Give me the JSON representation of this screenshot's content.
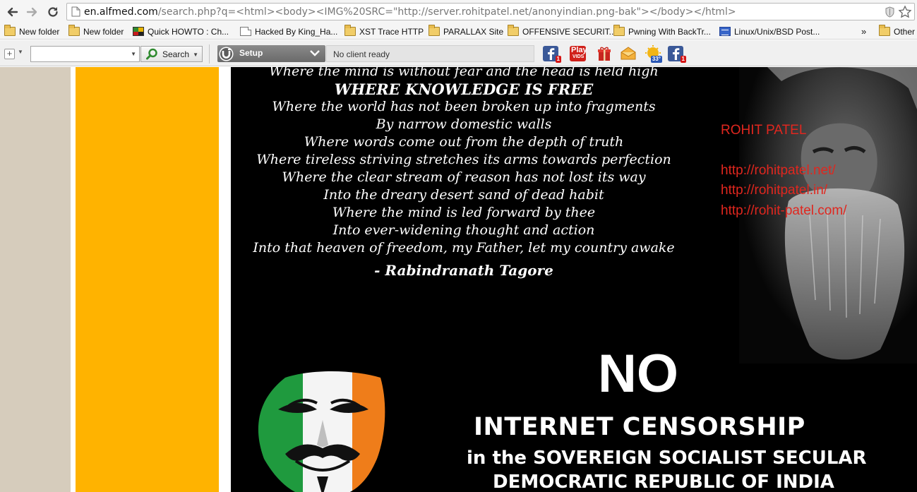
{
  "browser": {
    "url_host": "en.alfmed.com",
    "url_rest": "/search.php?q=<html><body><IMG%20SRC=\"http://server.rohitpatel.net/anonyindian.png-bak\"></body></html>",
    "bookmarks": [
      {
        "label": "New folder",
        "icon": "folder-icon"
      },
      {
        "label": "New folder",
        "icon": "folder-icon"
      },
      {
        "label": "Quick HOWTO : Ch...",
        "icon": "site-icon"
      },
      {
        "label": "Hacked By King_Ha...",
        "icon": "page-icon"
      },
      {
        "label": "XST Trace HTTP",
        "icon": "folder-icon"
      },
      {
        "label": "PARALLAX Site",
        "icon": "folder-icon"
      },
      {
        "label": "OFFENSIVE SECURIT...",
        "icon": "folder-icon"
      },
      {
        "label": "Pwning With BackTr...",
        "icon": "folder-icon"
      },
      {
        "label": "Linux/Unix/BSD Post...",
        "icon": "doc-icon"
      }
    ],
    "bookmarks_overflow": "»",
    "other_bookmarks": "Other"
  },
  "toolbar": {
    "search_value": "",
    "search_button": "Search",
    "utorrent_label": "Setup",
    "client_status": "No client ready",
    "icons": [
      {
        "name": "facebook-icon",
        "badge": "1"
      },
      {
        "name": "play-vids-icon",
        "text": "Play",
        "subtext": "VIDS"
      },
      {
        "name": "gift-icon"
      },
      {
        "name": "mail-icon"
      },
      {
        "name": "weather-icon",
        "badge": "33°"
      },
      {
        "name": "facebook-icon",
        "badge": "1"
      }
    ]
  },
  "page": {
    "poem_first_line": "Where the mind is without fear and the head is held high",
    "poem_heading": "WHERE KNOWLEDGE IS FREE",
    "poem_lines": [
      "Where the world has not been broken up into fragments",
      "By narrow domestic walls",
      "Where words come out from the depth of truth",
      "Where tireless striving stretches its arms towards perfection",
      "Where the clear stream of reason has not lost its way",
      "Into the dreary desert sand of dead habit",
      "Where the mind is led forward by thee",
      "Into ever-widening thought and action",
      "Into that heaven of freedom, my Father, let my country awake"
    ],
    "poem_author": "- Rabindranath Tagore",
    "credit_name": "ROHIT PATEL",
    "credit_links": [
      "http://rohitpatel.net/",
      "http://rohitpatel.in/",
      "http://rohit-patel.com/"
    ],
    "banner_no": "NO",
    "banner_line1": "INTERNET CENSORSHIP",
    "banner_line2": "in the SOVEREIGN SOCIALIST SECULAR",
    "banner_line3": "DEMOCRATIC REPUBLIC OF INDIA"
  },
  "colors": {
    "page_beige": "#d6ccbc",
    "page_yellow": "#ffb300",
    "panel_black": "#000000",
    "credit_red": "#e0271f"
  }
}
